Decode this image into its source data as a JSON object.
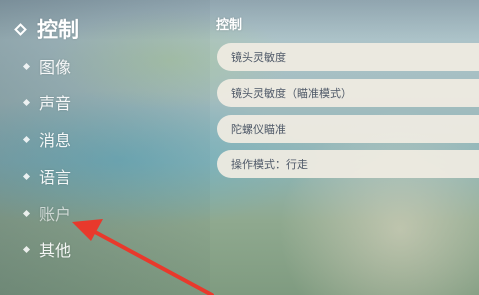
{
  "sidebar": {
    "items": [
      {
        "label": "控制"
      },
      {
        "label": "图像"
      },
      {
        "label": "声音"
      },
      {
        "label": "消息"
      },
      {
        "label": "语言"
      },
      {
        "label": "账户"
      },
      {
        "label": "其他"
      }
    ]
  },
  "main": {
    "section_title": "控制",
    "settings": [
      {
        "label": "镜头灵敏度"
      },
      {
        "label": "镜头灵敏度（瞄准模式）"
      },
      {
        "label": "陀螺仪瞄准"
      },
      {
        "label": "操作模式：行走"
      }
    ]
  },
  "annotation": {
    "arrow_color": "#e8392c"
  }
}
